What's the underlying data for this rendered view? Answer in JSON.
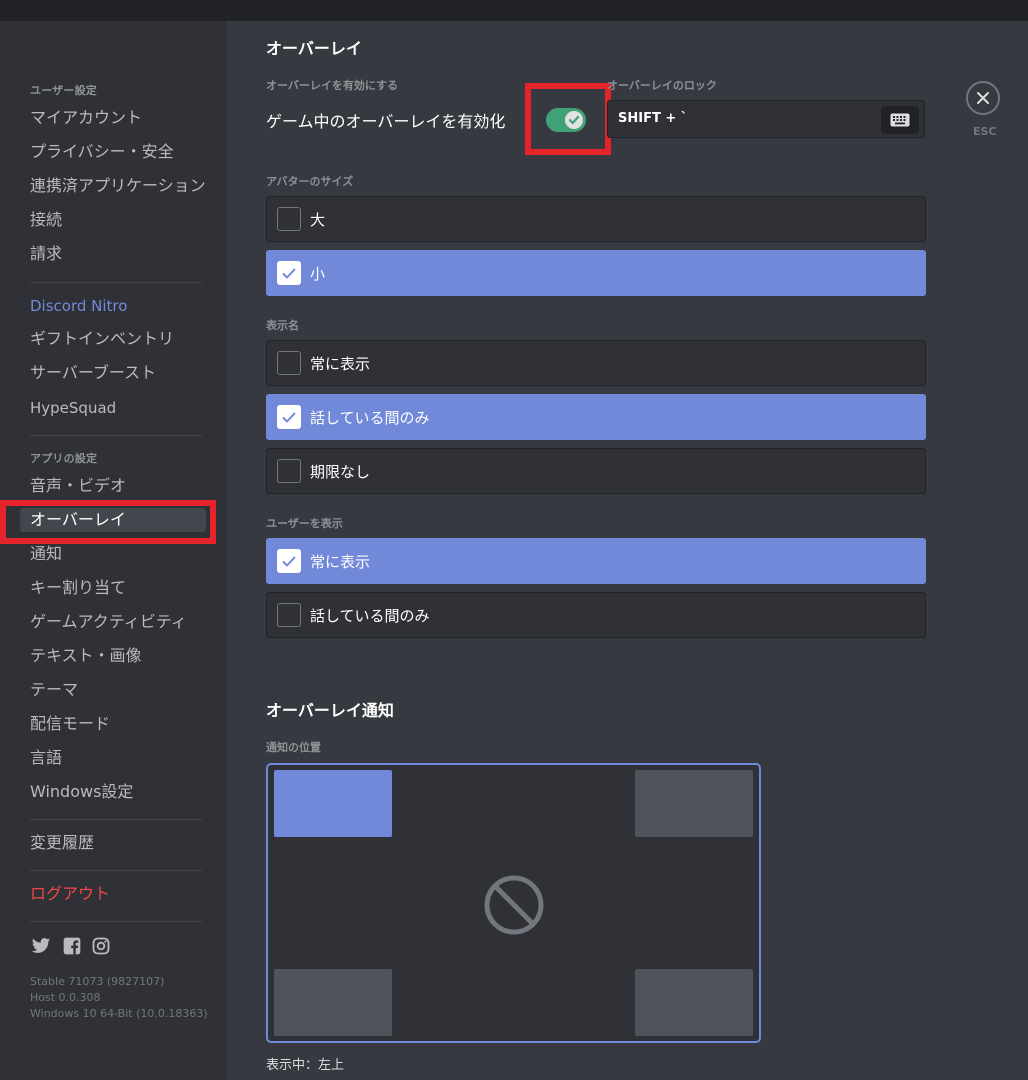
{
  "sidebar": {
    "user_settings_header": "ユーザー設定",
    "user_items": [
      "マイアカウント",
      "プライバシー・安全",
      "連携済アプリケーション",
      "接続",
      "請求"
    ],
    "nitro_label": "Discord Nitro",
    "nitro_items": [
      "ギフトインベントリ",
      "サーバーブースト",
      "HypeSquad"
    ],
    "app_settings_header": "アプリの設定",
    "app_items": [
      "音声・ビデオ",
      "オーバーレイ",
      "通知",
      "キー割り当て",
      "ゲームアクティビティ",
      "テキスト・画像",
      "テーマ",
      "配信モード",
      "言語",
      "Windows設定"
    ],
    "changelog": "変更履歴",
    "logout": "ログアウト",
    "social_icons": [
      "twitter-icon",
      "facebook-icon",
      "instagram-icon"
    ],
    "version_lines": [
      "Stable 71073 (9827107)",
      "Host 0.0.308",
      "Windows 10 64-Bit (10.0.18363)"
    ]
  },
  "overlay": {
    "title": "オーバーレイ",
    "enable_header": "オーバーレイを有効にする",
    "enable_label": "ゲーム中のオーバーレイを有効化",
    "enabled": true,
    "lock_header": "オーバーレイのロック",
    "lock_value": "SHIFT + `",
    "esc_label": "ESC",
    "avatar_size_header": "アバターのサイズ",
    "avatar_options": [
      "大",
      "小"
    ],
    "display_name_header": "表示名",
    "display_name_options": [
      "常に表示",
      "話している間のみ",
      "期限なし"
    ],
    "show_users_header": "ユーザーを表示",
    "show_users_options": [
      "常に表示",
      "話している間のみ"
    ]
  },
  "notifications": {
    "title": "オーバーレイ通知",
    "position_header": "通知の位置",
    "status": "表示中：左上"
  },
  "colors": {
    "accent": "#7289da",
    "toggle_on": "#43b581",
    "danger": "#f04747",
    "highlight": "#e5232a"
  }
}
